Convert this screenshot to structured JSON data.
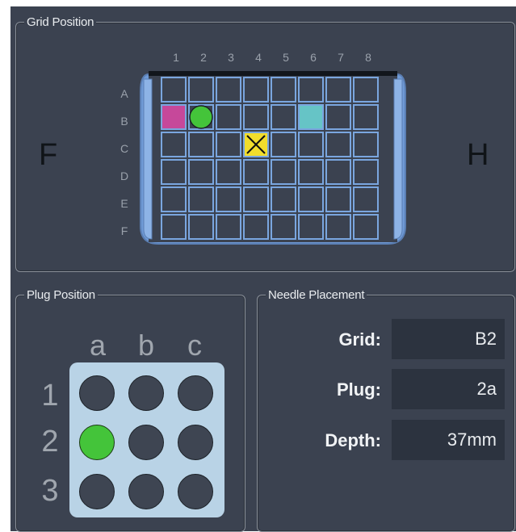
{
  "grid_position": {
    "title": "Grid Position",
    "left_label": "F",
    "right_label": "H",
    "columns": [
      "1",
      "2",
      "3",
      "4",
      "5",
      "6",
      "7",
      "8"
    ],
    "rows": [
      "A",
      "B",
      "C",
      "D",
      "E",
      "F"
    ],
    "markers": [
      {
        "cell": "B1",
        "shape": "square",
        "color": "#c6489a"
      },
      {
        "cell": "B2",
        "shape": "circle",
        "color": "#44c43a"
      },
      {
        "cell": "B6",
        "shape": "square",
        "color": "#66c4c6"
      },
      {
        "cell": "C4",
        "shape": "x-square",
        "color": "#f2dd2c"
      }
    ]
  },
  "plug_position": {
    "title": "Plug Position",
    "columns": [
      "a",
      "b",
      "c"
    ],
    "rows": [
      "1",
      "2",
      "3"
    ],
    "selected": "2a"
  },
  "needle_placement": {
    "title": "Needle Placement",
    "grid_label": "Grid:",
    "grid_value": "B2",
    "plug_label": "Plug:",
    "plug_value": "2a",
    "depth_label": "Depth:",
    "depth_value": "37mm"
  },
  "colors": {
    "panel_bg": "#3b4250",
    "grid_line": "#7aa6df",
    "plug_panel": "#b9d3e6",
    "active_green": "#44c43a"
  }
}
